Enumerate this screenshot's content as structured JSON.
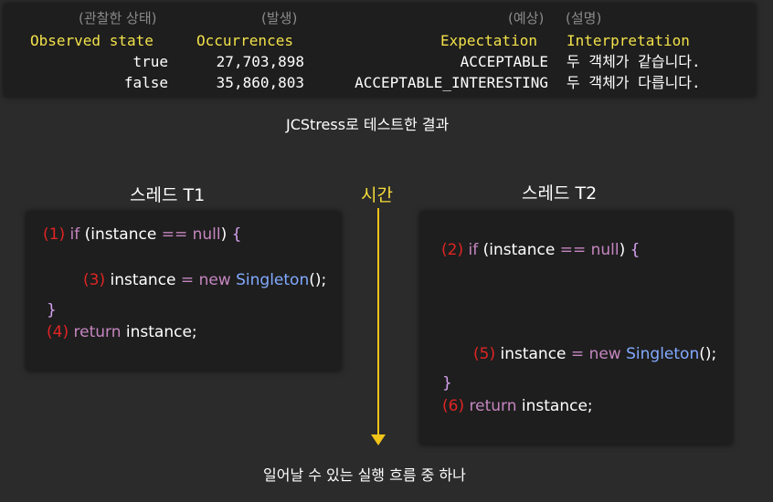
{
  "result_table": {
    "kor_headers": {
      "state": "(관찰한 상태)",
      "occurrences": "(발생)",
      "expectation": "(예상)",
      "interpretation": "(설명)"
    },
    "headers": {
      "state": "Observed state",
      "occurrences": "Occurrences",
      "expectation": "Expectation",
      "interpretation": "Interpretation"
    },
    "rows": [
      {
        "state": "true",
        "occurrences": "27,703,898",
        "expectation": "ACCEPTABLE",
        "interpretation": "두 객체가 같습니다."
      },
      {
        "state": "false",
        "occurrences": "35,860,803",
        "expectation": "ACCEPTABLE_INTERESTING",
        "interpretation": "두 객체가 다릅니다."
      }
    ]
  },
  "result_caption": "JCStress로 테스트한 결과",
  "thread1": {
    "title": "스레드 T1",
    "lines": [
      {
        "num": "(1)",
        "kw": "if",
        "p1": " (",
        "ident": "instance",
        "op": " == ",
        "kw2": "null",
        "p2": ") ",
        "brace": "{"
      },
      {
        "num": "(3)",
        "ident": " instance ",
        "op": "=",
        "kw": " new ",
        "cls": "Singleton",
        "tail": "();"
      },
      {
        "brace": "}"
      },
      {
        "num": "(4)",
        "kw": " return",
        "tail": " instance;"
      }
    ]
  },
  "thread2": {
    "title": "스레드 T2",
    "lines": [
      {
        "num": "(2)",
        "kw": "if",
        "p1": " (",
        "ident": "instance",
        "op": " == ",
        "kw2": "null",
        "p2": ") ",
        "brace": "{"
      },
      {
        "num": "(5)",
        "ident": " instance ",
        "op": "=",
        "kw": " new ",
        "cls": "Singleton",
        "tail": "();"
      },
      {
        "brace": "}"
      },
      {
        "num": "(6)",
        "kw": " return",
        "tail": " instance;"
      }
    ]
  },
  "time_label": "시간",
  "flow_caption": "일어날 수 있는 실행 흐름 중 하나",
  "colors": {
    "background": "#2b2b2b",
    "panel": "#1e1e1e",
    "header_yellow": "#f2e14a",
    "line_number_red": "#e02424",
    "keyword_purple": "#c586c0",
    "class_blue": "#82aaff",
    "arrow_yellow": "#f0c419"
  }
}
